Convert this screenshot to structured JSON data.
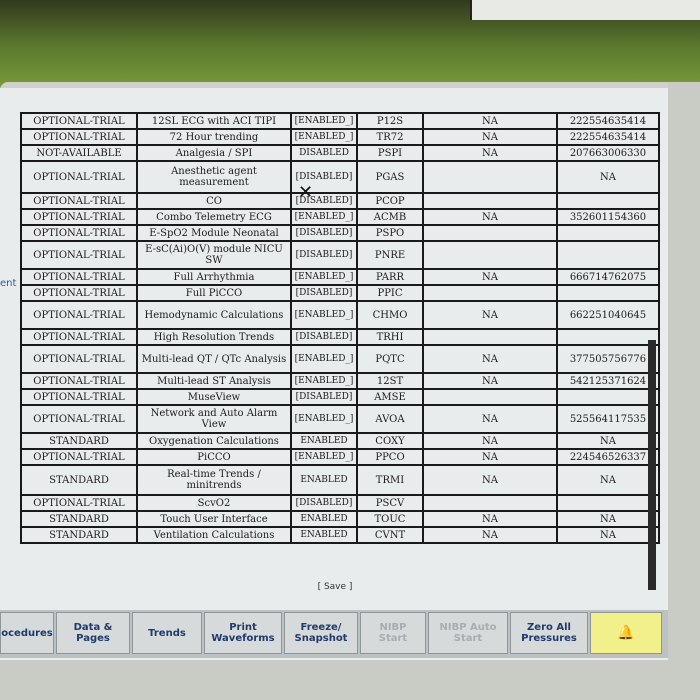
{
  "screen": {
    "left_edge_fragment": "ent",
    "save_label": "[ Save ]",
    "rows": [
      {
        "status": "OPTIONAL-TRIAL",
        "name": "12SL ECG with ACI TIPI",
        "state": "[ENABLED_]",
        "code": "P12S",
        "na": "NA",
        "key": "222554635414"
      },
      {
        "status": "OPTIONAL-TRIAL",
        "name": "72 Hour trending",
        "state": "[ENABLED_]",
        "code": "TR72",
        "na": "NA",
        "key": "222554635414"
      },
      {
        "status": "NOT-AVAILABLE",
        "name": "Analgesia / SPI",
        "state": "DISABLED",
        "code": "PSPI",
        "na": "NA",
        "key": "207663006330"
      },
      {
        "status": "OPTIONAL-TRIAL",
        "name": "Anesthetic agent measurement",
        "state": "[DISABLED]",
        "code": "PGAS",
        "na": "",
        "key": "NA"
      },
      {
        "status": "OPTIONAL-TRIAL",
        "name": "CO",
        "state": "[DISABLED]",
        "code": "PCOP",
        "na": "",
        "key": ""
      },
      {
        "status": "OPTIONAL-TRIAL",
        "name": "Combo Telemetry ECG",
        "state": "[ENABLED_]",
        "code": "ACMB",
        "na": "NA",
        "key": "352601154360"
      },
      {
        "status": "OPTIONAL-TRIAL",
        "name": "E-SpO2 Module Neonatal",
        "state": "[DISABLED]",
        "code": "PSPO",
        "na": "",
        "key": ""
      },
      {
        "status": "OPTIONAL-TRIAL",
        "name": "E-sC(Ai)O(V) module NICU SW",
        "state": "[DISABLED]",
        "code": "PNRE",
        "na": "",
        "key": ""
      },
      {
        "status": "OPTIONAL-TRIAL",
        "name": "Full Arrhythmia",
        "state": "[ENABLED_]",
        "code": "PARR",
        "na": "NA",
        "key": "666714762075"
      },
      {
        "status": "OPTIONAL-TRIAL",
        "name": "Full PiCCO",
        "state": "[DISABLED]",
        "code": "PPIC",
        "na": "",
        "key": ""
      },
      {
        "status": "OPTIONAL-TRIAL",
        "name": "Hemodynamic Calculations",
        "state": "[ENABLED_]",
        "code": "CHMO",
        "na": "NA",
        "key": "662251040645"
      },
      {
        "status": "OPTIONAL-TRIAL",
        "name": "High Resolution Trends",
        "state": "[DISABLED]",
        "code": "TRHI",
        "na": "",
        "key": ""
      },
      {
        "status": "OPTIONAL-TRIAL",
        "name": "Multi-lead QT / QTc Analysis",
        "state": "[ENABLED_]",
        "code": "PQTC",
        "na": "NA",
        "key": "377505756776"
      },
      {
        "status": "OPTIONAL-TRIAL",
        "name": "Multi-lead ST Analysis",
        "state": "[ENABLED_]",
        "code": "12ST",
        "na": "NA",
        "key": "542125371624"
      },
      {
        "status": "OPTIONAL-TRIAL",
        "name": "MuseView",
        "state": "[DISABLED]",
        "code": "AMSE",
        "na": "",
        "key": ""
      },
      {
        "status": "OPTIONAL-TRIAL",
        "name": "Network and Auto Alarm View",
        "state": "[ENABLED_]",
        "code": "AVOA",
        "na": "NA",
        "key": "525564117535"
      },
      {
        "status": "STANDARD",
        "name": "Oxygenation Calculations",
        "state": "ENABLED",
        "code": "COXY",
        "na": "NA",
        "key": "NA"
      },
      {
        "status": "OPTIONAL-TRIAL",
        "name": "PiCCO",
        "state": "[ENABLED_]",
        "code": "PPCO",
        "na": "NA",
        "key": "224546526337"
      },
      {
        "status": "STANDARD",
        "name": "Real-time Trends / minitrends",
        "state": "ENABLED",
        "code": "TRMI",
        "na": "NA",
        "key": "NA"
      },
      {
        "status": "OPTIONAL-TRIAL",
        "name": "ScvO2",
        "state": "[DISABLED]",
        "code": "PSCV",
        "na": "",
        "key": ""
      },
      {
        "status": "STANDARD",
        "name": "Touch User Interface",
        "state": "ENABLED",
        "code": "TOUC",
        "na": "NA",
        "key": "NA"
      },
      {
        "status": "STANDARD",
        "name": "Ventilation Calculations",
        "state": "ENABLED",
        "code": "CVNT",
        "na": "NA",
        "key": "NA"
      }
    ]
  },
  "softkeys": [
    {
      "label": "ocedures",
      "enabled": true
    },
    {
      "label": "Data &\nPages",
      "enabled": true
    },
    {
      "label": "Trends",
      "enabled": true
    },
    {
      "label": "Print\nWaveforms",
      "enabled": true
    },
    {
      "label": "Freeze/\nSnapshot",
      "enabled": true
    },
    {
      "label": "NIBP\nStart",
      "enabled": false
    },
    {
      "label": "NIBP Auto\nStart",
      "enabled": false
    },
    {
      "label": "Zero All\nPressures",
      "enabled": true
    },
    {
      "label": "",
      "enabled": true,
      "icon": "alarm-bell-icon"
    }
  ],
  "colors": {
    "softkey_text": "#1f3a6b",
    "alarm_key": "#f2f08a"
  }
}
